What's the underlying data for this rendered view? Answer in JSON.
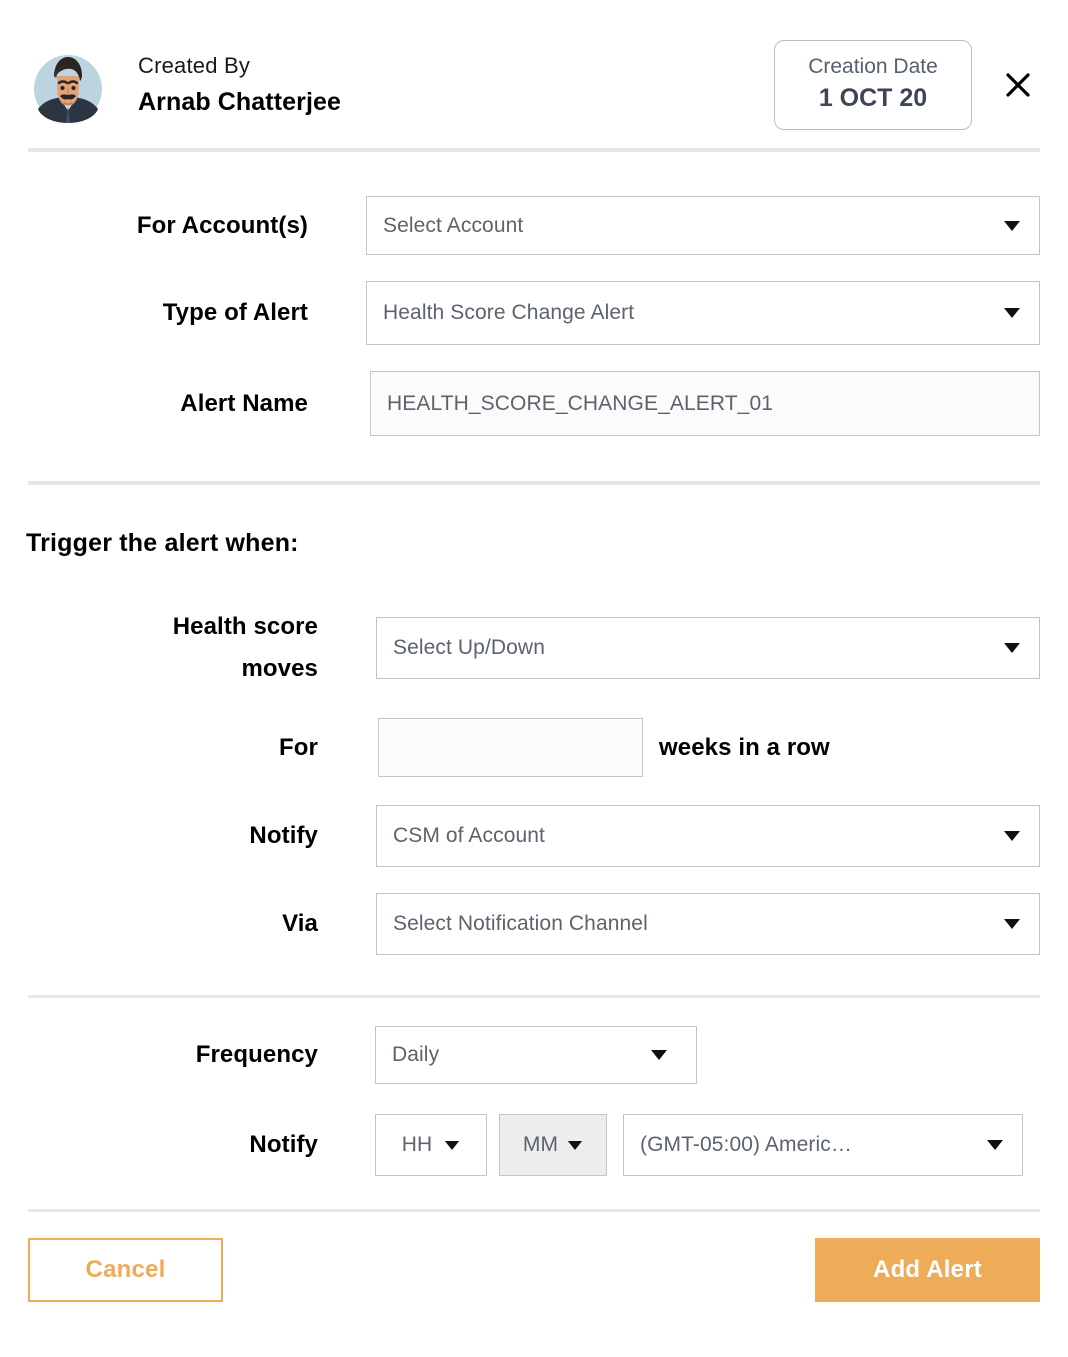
{
  "header": {
    "created_by_label": "Created By",
    "created_by_name": "Arnab Chatterjee",
    "creation_date_label": "Creation Date",
    "creation_date_value": "1 OCT 20",
    "close_icon": "close-icon",
    "avatar_icon": "user-avatar"
  },
  "form": {
    "account": {
      "label": "For Account(s)",
      "value": "Select Account",
      "caret_icon": "chevron-down-icon"
    },
    "alert_type": {
      "label": "Type of Alert",
      "value": "Health Score Change Alert",
      "caret_icon": "chevron-down-icon"
    },
    "alert_name": {
      "label": "Alert Name",
      "value": "HEALTH_SCORE_CHANGE_ALERT_01"
    }
  },
  "trigger": {
    "title": "Trigger the alert when:",
    "health_move": {
      "label_line1": "Health score",
      "label_line2": "moves",
      "value": "Select Up/Down",
      "caret_icon": "chevron-down-icon"
    },
    "weeks": {
      "label": "For",
      "value": "",
      "suffix": "weeks in a row"
    },
    "notify_who": {
      "label": "Notify",
      "value": "CSM of Account",
      "caret_icon": "chevron-down-icon"
    },
    "via": {
      "label": "Via",
      "value": "Select Notification Channel",
      "caret_icon": "chevron-down-icon"
    }
  },
  "schedule": {
    "frequency": {
      "label": "Frequency",
      "value": "Daily",
      "caret_icon": "chevron-down-icon"
    },
    "notify_time": {
      "label": "Notify",
      "hour_value": "HH",
      "minute_value": "MM",
      "timezone_value": "(GMT-05:00) Americ…",
      "caret_icon": "chevron-down-icon"
    }
  },
  "footer": {
    "cancel_label": "Cancel",
    "submit_label": "Add Alert"
  },
  "colors": {
    "accent": "#efac58",
    "border": "#c6c6c6",
    "placeholder_text": "#5c636d",
    "divider": "#e6e6e6",
    "shaded_field": "#ededed"
  }
}
